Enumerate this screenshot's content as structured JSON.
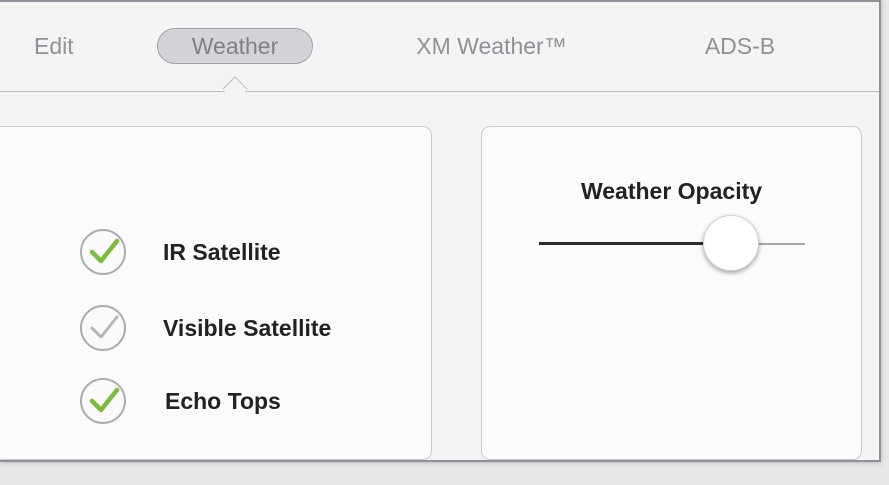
{
  "tabs": [
    {
      "label": "Edit",
      "selected": false
    },
    {
      "label": "Weather",
      "selected": true
    },
    {
      "label": "XM Weather™",
      "selected": false
    },
    {
      "label": "ADS-B",
      "selected": false
    }
  ],
  "layers": [
    {
      "label": "IR Satellite",
      "checked": true
    },
    {
      "label": "Visible Satellite",
      "checked": false
    },
    {
      "label": "Echo Tops",
      "checked": true
    }
  ],
  "opacity": {
    "title": "Weather Opacity",
    "value": 0.72
  },
  "colors": {
    "check_on": "#7dbb3c",
    "check_off": "#b4b7ba"
  }
}
